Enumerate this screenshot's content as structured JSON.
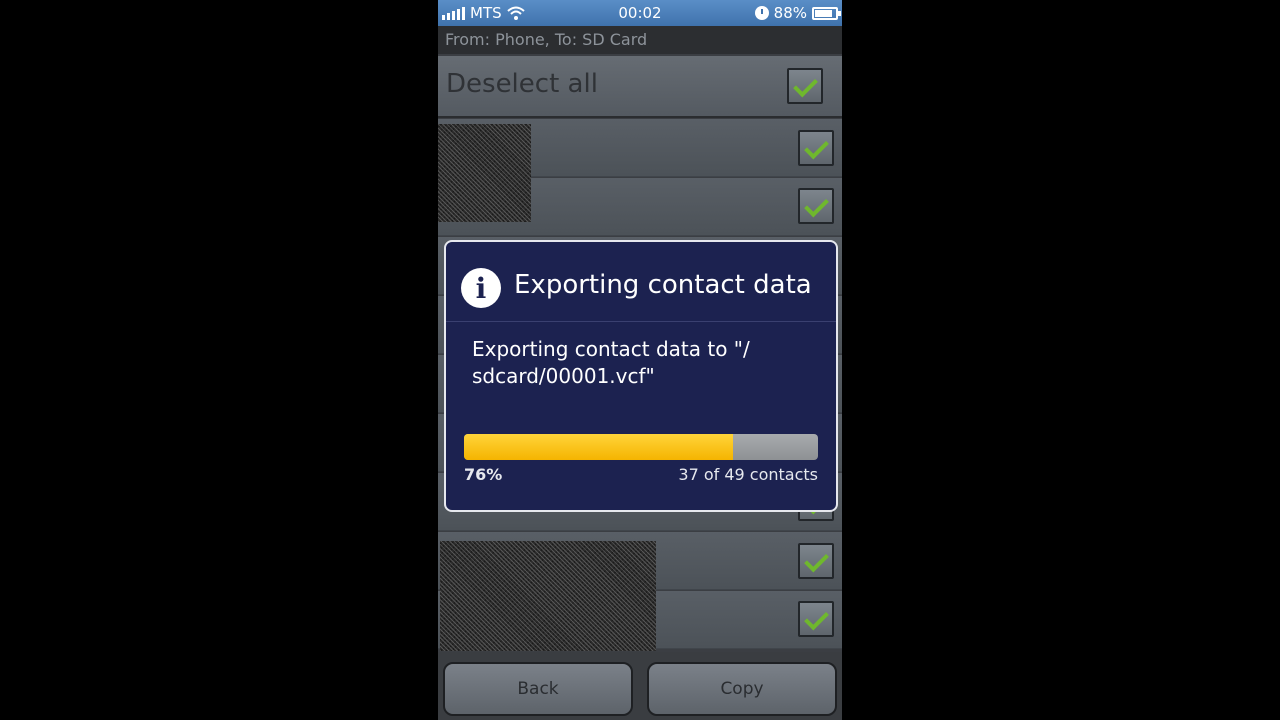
{
  "status_bar": {
    "carrier": "MTS",
    "time": "00:02",
    "battery": "88%"
  },
  "subheader": "From: Phone, To: SD Card",
  "select_all": {
    "label": "Deselect all",
    "checked": true
  },
  "contacts": [
    {
      "checked": true
    },
    {
      "checked": true
    },
    {
      "checked": true
    },
    {
      "checked": true
    },
    {
      "checked": true
    }
  ],
  "dialog": {
    "title": "Exporting contact data",
    "message": "Exporting contact data to \"/ sdcard/00001.vcf\"",
    "progress_fraction": 0.76,
    "percent_label": "76%",
    "count_label": "37 of 49 contacts"
  },
  "buttons": {
    "back": "Back",
    "copy": "Copy"
  },
  "colors": {
    "progress_fill": "#f5b400",
    "check": "#6fb82d",
    "dialog_bg": "#1c2250"
  }
}
